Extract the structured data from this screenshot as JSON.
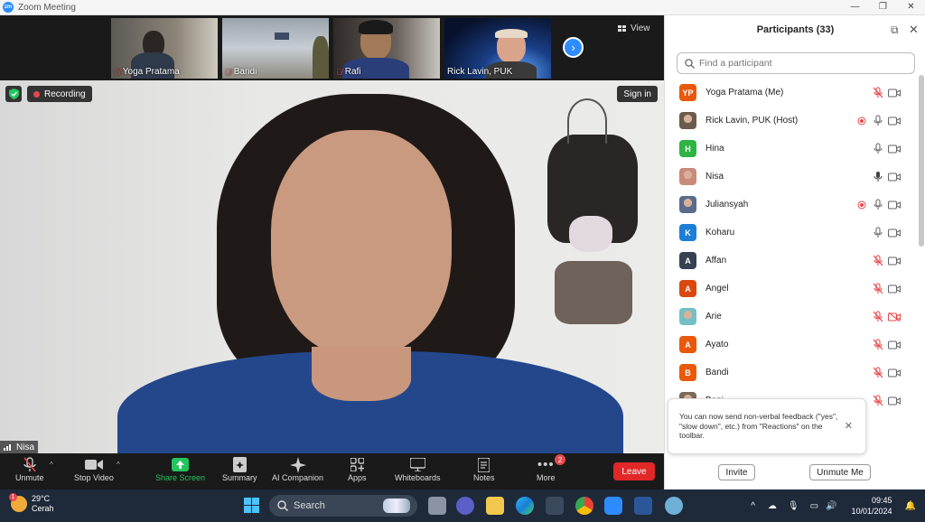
{
  "window": {
    "title": "Zoom Meeting",
    "app_logo": "zm",
    "minimize": "—",
    "restore": "❐",
    "close": "✕"
  },
  "thumbnails": [
    {
      "name": "Yoga Pratama",
      "muted": true
    },
    {
      "name": "Bandi",
      "muted": true
    },
    {
      "name": "Rafi",
      "muted": true
    },
    {
      "name": "Rick Lavin, PUK",
      "muted": false
    }
  ],
  "view_label": "View",
  "recording_label": "Recording",
  "signin_label": "Sign in",
  "active_speaker": "Nisa",
  "toolbar": {
    "unmute": "Unmute",
    "stop_video": "Stop Video",
    "share_screen": "Share Screen",
    "summary": "Summary",
    "ai_companion": "AI Companion",
    "apps": "Apps",
    "whiteboards": "Whiteboards",
    "notes": "Notes",
    "more": "More",
    "more_badge": "2",
    "leave": "Leave"
  },
  "participants_panel": {
    "title": "Participants (33)",
    "search_placeholder": "Find a participant",
    "participants": [
      {
        "initials": "YP",
        "name": "Yoga Pratama (Me)",
        "color": "#e8590c",
        "mic": "muted",
        "video": "on",
        "rec": false,
        "photo": false
      },
      {
        "initials": "",
        "name": "Rick Lavin, PUK (Host)",
        "color": "#6b5b4b",
        "mic": "on",
        "video": "on",
        "rec": true,
        "photo": true
      },
      {
        "initials": "H",
        "name": "Hina",
        "color": "#2fb344",
        "mic": "on",
        "video": "on",
        "rec": false,
        "photo": false
      },
      {
        "initials": "",
        "name": "Nisa",
        "color": "#c98a7a",
        "mic": "active",
        "video": "on",
        "rec": false,
        "photo": true
      },
      {
        "initials": "",
        "name": "Juliansyah",
        "color": "#5a6b8c",
        "mic": "on",
        "video": "on",
        "rec": true,
        "photo": true
      },
      {
        "initials": "K",
        "name": "Koharu",
        "color": "#1c7ed6",
        "mic": "on",
        "video": "on",
        "rec": false,
        "photo": false
      },
      {
        "initials": "A",
        "name": "Affan",
        "color": "#364152",
        "mic": "muted",
        "video": "on",
        "rec": false,
        "photo": false
      },
      {
        "initials": "A",
        "name": "Angel",
        "color": "#d9480f",
        "mic": "muted",
        "video": "on",
        "rec": false,
        "photo": false
      },
      {
        "initials": "",
        "name": "Arie",
        "color": "#74c0c4",
        "mic": "muted",
        "video": "off",
        "rec": false,
        "photo": true
      },
      {
        "initials": "A",
        "name": "Ayato",
        "color": "#e8590c",
        "mic": "muted",
        "video": "on",
        "rec": false,
        "photo": false
      },
      {
        "initials": "B",
        "name": "Bandi",
        "color": "#e8590c",
        "mic": "muted",
        "video": "on",
        "rec": false,
        "photo": false
      },
      {
        "initials": "",
        "name": "Bani",
        "color": "#7a6a5a",
        "mic": "muted",
        "video": "on",
        "rec": false,
        "photo": true
      }
    ],
    "toast_text": "You can now send non-verbal feedback (\"yes\", \"slow down\", etc.) from \"Reactions\" on the toolbar.",
    "invite": "Invite",
    "unmute_me": "Unmute Me"
  },
  "taskbar": {
    "temperature": "29°C",
    "weather": "Cerah",
    "weather_badge": "1",
    "search": "Search",
    "time": "09:45",
    "date": "10/01/2024"
  },
  "colors": {
    "accent": "#2d8cff",
    "leave": "#e02828",
    "muted_red": "#e5484d",
    "share_green": "#22c55e"
  }
}
